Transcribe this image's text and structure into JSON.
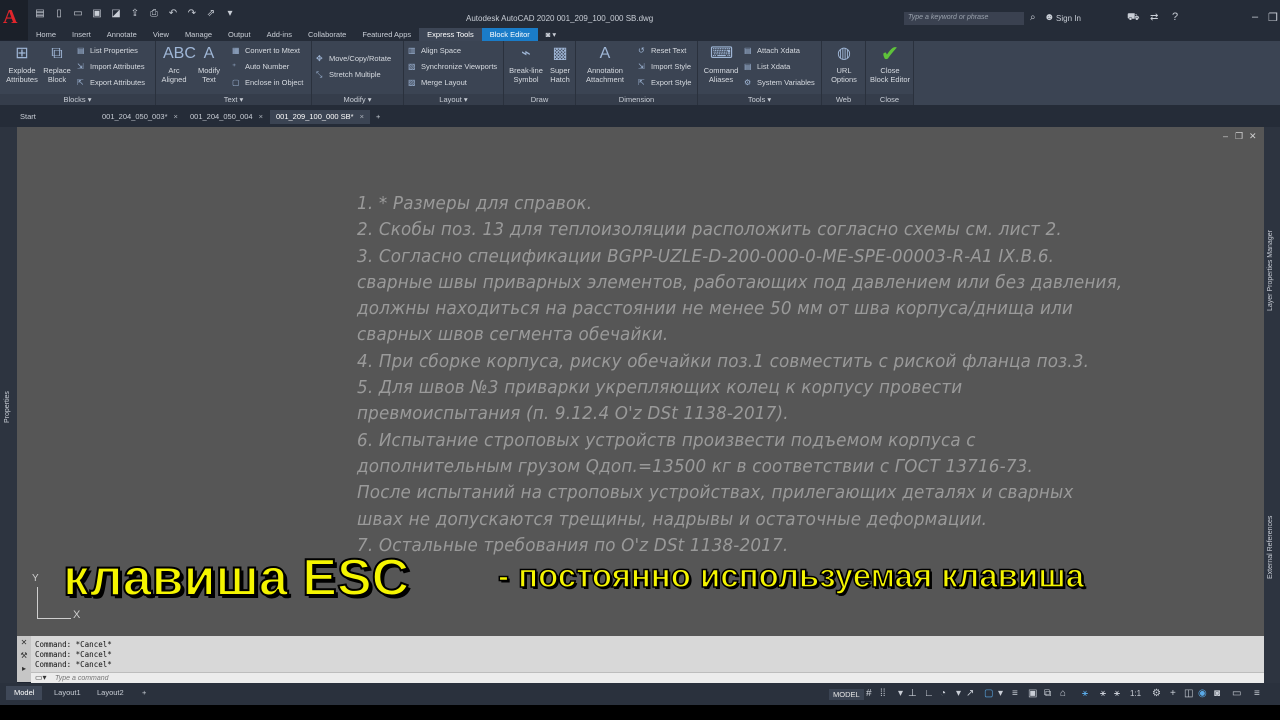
{
  "title_bar": {
    "window_title": "Autodesk AutoCAD 2020    001_209_100_000 SB.dwg",
    "search_placeholder": "Type a keyword or phrase",
    "sign_in": "Sign In"
  },
  "ribbon_tabs": [
    "Home",
    "Insert",
    "Annotate",
    "View",
    "Manage",
    "Output",
    "Add-ins",
    "Collaborate",
    "Featured Apps",
    "Express Tools",
    "Block Editor"
  ],
  "ribbon": {
    "blocks": {
      "title": "Blocks",
      "explode": "Explode\nAttributes",
      "explode_l1": "Explode",
      "explode_l2": "Attributes",
      "replace_l1": "Replace",
      "replace_l2": "Block",
      "list_properties": "List Properties",
      "import_attributes": "Import Attributes",
      "export_attributes": "Export Attributes"
    },
    "text": {
      "title": "Text",
      "arc_l1": "Arc",
      "arc_l2": "Aligned",
      "modify_l1": "Modify",
      "modify_l2": "Text",
      "convert": "Convert to Mtext",
      "auto_number": "Auto Number",
      "enclose": "Enclose in Object"
    },
    "modify": {
      "title": "Modify",
      "move_copy_rotate": "Move/Copy/Rotate",
      "stretch_multiple": "Stretch Multiple"
    },
    "layout": {
      "title": "Layout",
      "align_space": "Align Space",
      "sync_viewports": "Synchronize Viewports",
      "merge_layout": "Merge Layout"
    },
    "draw": {
      "title": "Draw",
      "breakline_l1": "Break-line",
      "breakline_l2": "Symbol",
      "super_l1": "Super",
      "super_l2": "Hatch"
    },
    "dimension": {
      "title": "Dimension",
      "annotation_l1": "Annotation",
      "annotation_l2": "Attachment",
      "reset_text": "Reset Text",
      "import_style": "Import Style",
      "export_style": "Export Style"
    },
    "tools": {
      "title": "Tools",
      "command_l1": "Command",
      "command_l2": "Aliases",
      "attach_xdata": "Attach Xdata",
      "list_xdata": "List Xdata",
      "system_variables": "System Variables"
    },
    "web": {
      "title": "Web",
      "url_l1": "URL",
      "url_l2": "Options"
    },
    "close": {
      "title": "Close",
      "close_l1": "Close",
      "close_l2": "Block Editor"
    }
  },
  "file_tabs": {
    "start": "Start",
    "tab1": "001_204_050_003*",
    "tab2": "001_204_050_004",
    "tab3": "001_209_100_000 SB*",
    "add": "+"
  },
  "palettes": {
    "properties": "Properties",
    "layer_manager": "Layer Properties Manager",
    "external_refs": "External References"
  },
  "notes": [
    "1.  * Размеры для справок.",
    "2.  Скобы поз. 13 для теплоизоляции расположить согласно схемы см. лист 2.",
    "3.  Согласно спецификации BGPP-UZLE-D-200-000-0-ME-SPE-00003-R-A1 IX.B.6.",
    "сварные швы приварных элементов, работающих под давлением или без давления,",
    "должны находиться на расстоянии не менее 50 мм от шва корпуса/днища или",
    "сварных швов сегмента обечайки.",
    "4.  При сборке корпуса, риску обечайки поз.1 совместить с риской фланца поз.3.",
    "5.  Для швов №3 приварки укрепляющих колец к корпусу провести",
    "превмоиспытания (п. 9.12.4  O'z DSt  1138-2017).",
    "6.  Испытание строповых устройств произвести подъемом корпуса с",
    "дополнительным грузом Qдоп.=13500 кг в соответствии с ГОСТ 13716-73.",
    "После испытаний на строповых устройствах, прилегающих деталях и сварных",
    "швах не допускаются трещины, надрывы и остаточные деформации.",
    "7.  Остальные требования по O'z DSt  1138-2017."
  ],
  "ucs": {
    "x": "X",
    "y": "Y"
  },
  "overlay": {
    "main": "клавиша ESC",
    "sub": "- постоянно используемая клавиша"
  },
  "command": {
    "history": [
      "Command: *Cancel*",
      "Command: *Cancel*",
      "Command: *Cancel*"
    ],
    "placeholder": "Type a command"
  },
  "status": {
    "model_tab": "Model",
    "layout1": "Layout1",
    "layout2": "Layout2",
    "add": "+",
    "model_label": "MODEL",
    "scale": "1:1"
  },
  "colors": {
    "accent": "#1a7cc8",
    "overlay_text": "#f5f500",
    "canvas": "#565656"
  }
}
